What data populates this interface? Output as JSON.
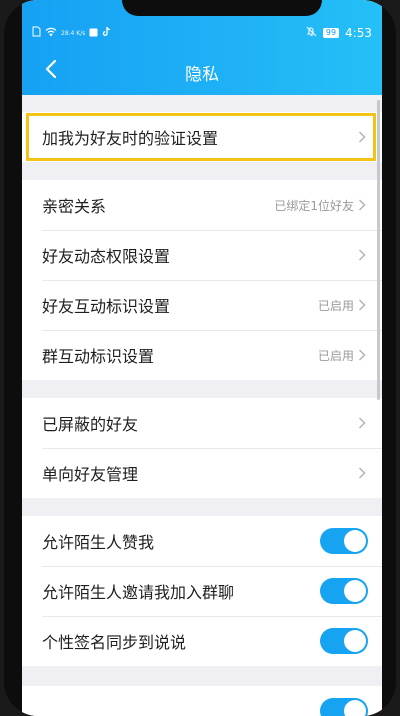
{
  "status": {
    "network_speed": "28.4 K/s",
    "battery": "99",
    "time": "4:53"
  },
  "header": {
    "title": "隐私"
  },
  "groups": [
    {
      "items": [
        {
          "label": "加我为好友时的验证设置",
          "value": "",
          "type": "link"
        }
      ]
    },
    {
      "items": [
        {
          "label": "亲密关系",
          "value": "已绑定1位好友",
          "type": "link"
        },
        {
          "label": "好友动态权限设置",
          "value": "",
          "type": "link"
        },
        {
          "label": "好友互动标识设置",
          "value": "已启用",
          "type": "link"
        },
        {
          "label": "群互动标识设置",
          "value": "已启用",
          "type": "link"
        }
      ]
    },
    {
      "items": [
        {
          "label": "已屏蔽的好友",
          "value": "",
          "type": "link"
        },
        {
          "label": "单向好友管理",
          "value": "",
          "type": "link"
        }
      ]
    },
    {
      "items": [
        {
          "label": "允许陌生人赞我",
          "type": "toggle",
          "on": true
        },
        {
          "label": "允许陌生人邀请我加入群聊",
          "type": "toggle",
          "on": true
        },
        {
          "label": "个性签名同步到说说",
          "type": "toggle",
          "on": true
        }
      ]
    }
  ],
  "colors": {
    "accent": "#15a3f2",
    "highlight": "#f3c318",
    "background": "#efeff4"
  },
  "icons": {
    "back": "chevron-left-icon",
    "row_arrow": "chevron-right-icon"
  }
}
